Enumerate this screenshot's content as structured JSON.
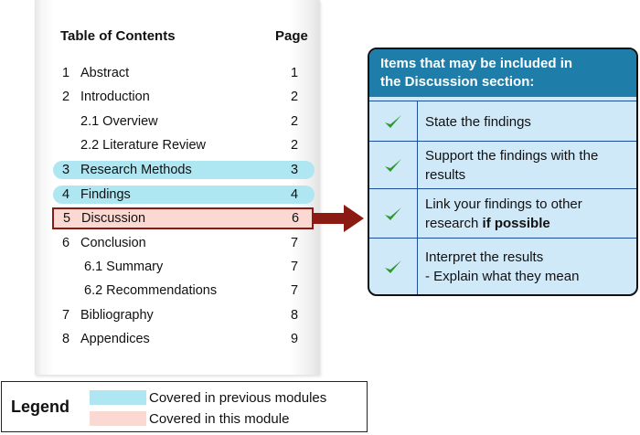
{
  "toc": {
    "title": "Table of Contents",
    "page_header": "Page",
    "entries": [
      {
        "num": "1",
        "label": "Abstract",
        "page": "1",
        "status": "none"
      },
      {
        "num": "2",
        "label": "Introduction",
        "page": "2",
        "status": "none"
      },
      {
        "num": "",
        "label": "2.1 Overview",
        "page": "2",
        "status": "none"
      },
      {
        "num": "",
        "label": "2.2 Literature Review",
        "page": "2",
        "status": "none"
      },
      {
        "num": "3",
        "label": "Research Methods",
        "page": "3",
        "status": "previous"
      },
      {
        "num": "4",
        "label": "Findings",
        "page": "4",
        "status": "previous"
      },
      {
        "num": "5",
        "label": "Discussion",
        "page": "6",
        "status": "current"
      },
      {
        "num": "6",
        "label": "Conclusion",
        "page": "7",
        "status": "none"
      },
      {
        "num": "",
        "label": "6.1 Summary",
        "page": "7",
        "status": "none"
      },
      {
        "num": "",
        "label": "6.2 Recommendations",
        "page": "7",
        "status": "none"
      },
      {
        "num": "7",
        "label": "Bibliography",
        "page": "8",
        "status": "none"
      },
      {
        "num": "8",
        "label": "Appendices",
        "page": "9",
        "status": "none"
      }
    ]
  },
  "discussion": {
    "heading_line1": "Items that may be included in",
    "heading_line2": "the Discussion section:",
    "items": [
      {
        "line1": "State the findings",
        "line2": "",
        "line2_bold": ""
      },
      {
        "line1": "Support the findings with the",
        "line2": "results",
        "line2_bold": ""
      },
      {
        "line1": "Link your findings to other",
        "line2": "research ",
        "line2_bold": "if possible"
      },
      {
        "line1": "Interpret the results",
        "line2": "-  Explain what they mean",
        "line2_bold": ""
      }
    ],
    "check_icon": "check-icon"
  },
  "legend": {
    "title": "Legend",
    "previous_label": "Covered in previous modules",
    "current_label": "Covered in this module"
  },
  "colors": {
    "previous": "#aee6f2",
    "current": "#fbd9d2",
    "current_border": "#8b1a12",
    "box_header": "#1e7ea9",
    "box_body": "#cfe9f9",
    "check": "#2e9a2e",
    "arrow": "#8b1a12"
  }
}
